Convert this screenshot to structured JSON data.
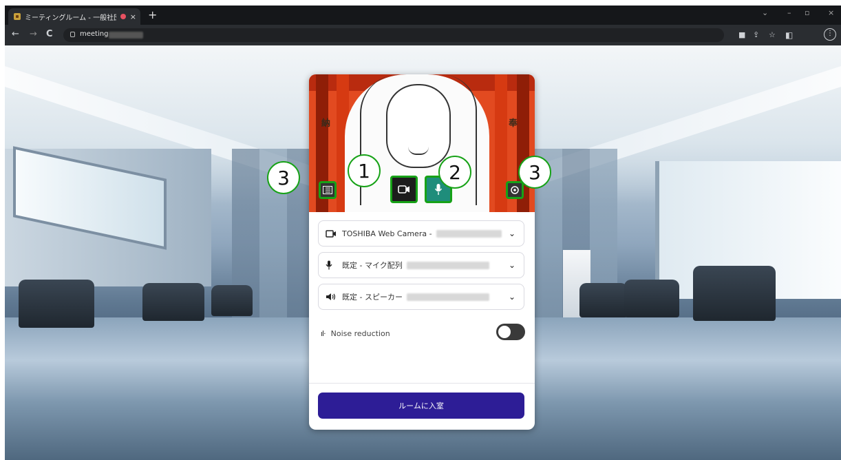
{
  "browser": {
    "tab_title": "ミーティングルーム - 一般社団法...",
    "tab_close": "×",
    "new_tab": "+",
    "url_text": "meeting",
    "window_controls": [
      "⌄",
      "–",
      "▫",
      "×"
    ],
    "nav": {
      "back": "←",
      "forward": "→",
      "reload": "C"
    }
  },
  "dialog": {
    "callouts": [
      "3",
      "1",
      "2",
      "3"
    ],
    "icons": {
      "blur_button": "background-blur-icon",
      "camera_button": "camera-icon",
      "mic_button": "microphone-icon",
      "settings_button": "settings-icon"
    },
    "camera_select": {
      "label": "TOSHIBA Web Camera -",
      "icon": "camera-icon"
    },
    "mic_select": {
      "label": "既定 - マイク配列",
      "icon": "microphone-icon"
    },
    "speaker_select": {
      "label": "既定 - スピーカー",
      "icon": "speaker-icon"
    },
    "noise_reduction": {
      "label": "Noise reduction",
      "enabled": false
    },
    "enter_button": "ルームに入室",
    "preview_kanji": [
      "納",
      "奉"
    ]
  },
  "colors": {
    "highlight_green": "#17a217",
    "enter_button": "#2d1d96",
    "mic_active": "#1f8d7b"
  }
}
